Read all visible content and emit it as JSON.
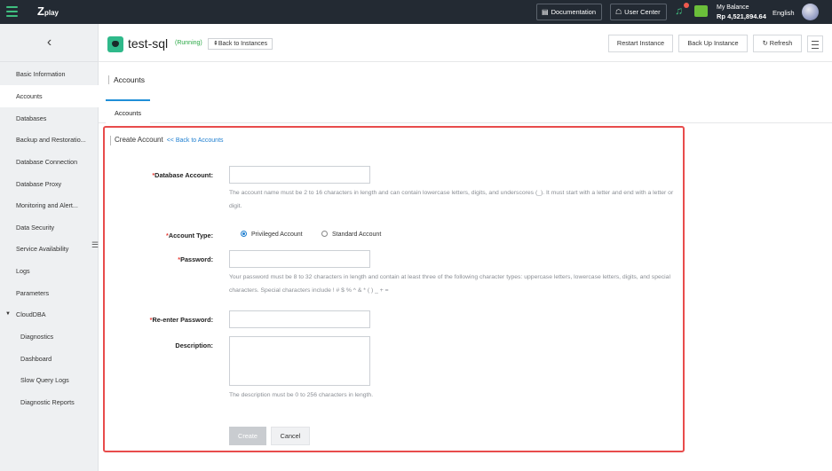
{
  "topbar": {
    "logo": "play",
    "documentation": "Documentation",
    "user_center": "User Center",
    "balance_label": "My Balance",
    "balance_value": "Rp 4,521,894.64",
    "language": "English",
    "accent_color": "#3fbf7f"
  },
  "sidebar": {
    "back_icon": "chevron-left-icon",
    "items": [
      {
        "label": "Basic Information"
      },
      {
        "label": "Accounts",
        "active": true
      },
      {
        "label": "Databases"
      },
      {
        "label": "Backup and Restoratio..."
      },
      {
        "label": "Database Connection"
      },
      {
        "label": "Database Proxy"
      },
      {
        "label": "Monitoring and Alert..."
      },
      {
        "label": "Data Security"
      },
      {
        "label": "Service Availability"
      },
      {
        "label": "Logs"
      },
      {
        "label": "Parameters"
      },
      {
        "label": "CloudDBA",
        "expanded": true
      },
      {
        "label": "Diagnostics"
      },
      {
        "label": "Dashboard"
      },
      {
        "label": "Slow Query Logs"
      },
      {
        "label": "Diagnostic Reports"
      }
    ]
  },
  "header": {
    "title": "test-sql",
    "status": "(Running)",
    "back_link": "Back to Instances",
    "restart": "Restart Instance",
    "backup": "Back Up Instance",
    "refresh": "Refresh"
  },
  "section": {
    "title": "Accounts",
    "tab": "Accounts"
  },
  "form": {
    "title": "Create Account",
    "back_link": "<< Back to Accounts",
    "db_account_label": "Database Account:",
    "db_account_hint": "The account name must be 2 to 16 characters in length and can contain lowercase letters, digits, and underscores (_). It must start with a letter and end with a letter or digit.",
    "account_type_label": "Account Type:",
    "type_privileged": "Privileged Account",
    "type_standard": "Standard Account",
    "selected_type": "Privileged Account",
    "password_label": "Password:",
    "password_hint": "Your password must be 8 to 32 characters in length and contain at least three of the following character types: uppercase letters, lowercase letters, digits, and special characters. Special characters include ! # $ % ^ & * ( ) _ + =",
    "reenter_label": "Re-enter Password:",
    "description_label": "Description:",
    "description_hint": "The description must be 0 to 256 characters in length.",
    "create": "Create",
    "cancel": "Cancel",
    "required_mark": "*",
    "highlight_color": "#e84c4c"
  }
}
